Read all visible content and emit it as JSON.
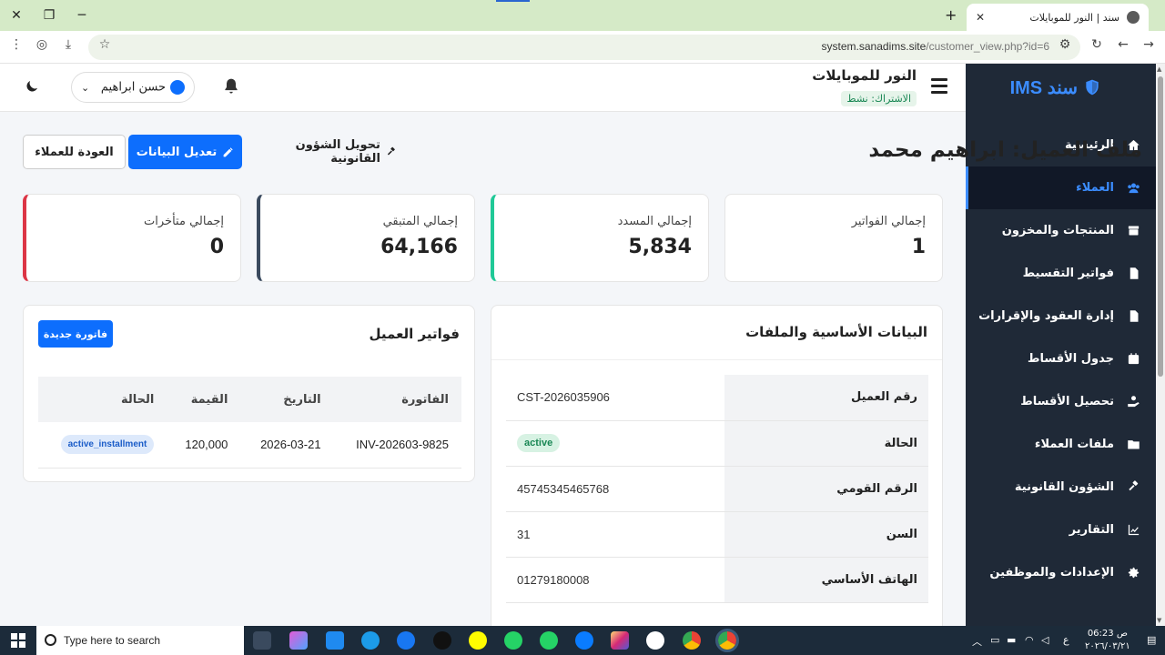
{
  "browser": {
    "tab_title": "سند | النور للموبايلات",
    "url_host": "system.sanadims.site",
    "url_path": "/customer_view.php?id=6"
  },
  "sidebar": {
    "brand": "سند IMS",
    "items": [
      {
        "label": "الرئيسية",
        "icon": "home-icon"
      },
      {
        "label": "العملاء",
        "icon": "users-icon",
        "active": true
      },
      {
        "label": "المنتجات والمخزون",
        "icon": "box-icon"
      },
      {
        "label": "فواتير التقسيط",
        "icon": "invoice-icon"
      },
      {
        "label": "إدارة العقود والإقرارات",
        "icon": "file-icon"
      },
      {
        "label": "جدول الأقساط",
        "icon": "calendar-icon"
      },
      {
        "label": "تحصيل الأقساط",
        "icon": "hand-coins-icon"
      },
      {
        "label": "ملفات العملاء",
        "icon": "folder-icon"
      },
      {
        "label": "الشؤون القانونية",
        "icon": "gavel-icon"
      },
      {
        "label": "التقارير",
        "icon": "chart-icon"
      },
      {
        "label": "الإعدادات والموظفين",
        "icon": "gear-icon"
      }
    ]
  },
  "header": {
    "shop_name": "النور للموبايلات",
    "subscription": "الاشتراك: نشط",
    "user_name": "حسن ابراهيم"
  },
  "page": {
    "title": "ملف العميل: ابراهيم محمد",
    "back_label": "العودة للعملاء",
    "edit_label": "تعديل البيانات",
    "legal_label": "تحويل الشؤون القانونية"
  },
  "stats": [
    {
      "label": "إجمالي الفواتير",
      "value": "1"
    },
    {
      "label": "إجمالي المسدد",
      "value": "5,834"
    },
    {
      "label": "إجمالي المتبقي",
      "value": "64,166"
    },
    {
      "label": "إجمالي متأخرات",
      "value": "0"
    }
  ],
  "info": {
    "title": "البيانات الأساسية والملفات",
    "rows": [
      {
        "key": "رقم العميل",
        "value": "CST-2026035906"
      },
      {
        "key": "الحالة",
        "value": "active"
      },
      {
        "key": "الرقم القومي",
        "value": "45745345465768"
      },
      {
        "key": "السن",
        "value": "31"
      },
      {
        "key": "الهاتف الأساسي",
        "value": "01279180008"
      }
    ]
  },
  "invoices": {
    "title": "فواتير العميل",
    "new_label": "فاتورة جديدة",
    "columns": [
      "الفاتورة",
      "التاريخ",
      "القيمة",
      "الحالة"
    ],
    "rows": [
      {
        "invoice": "INV-202603-9825",
        "date": "2026-03-21",
        "amount": "120,000",
        "status": "active_installment"
      }
    ]
  },
  "taskbar": {
    "search_placeholder": "Type here to search",
    "time": "06:23 ص",
    "date": "٢٠٢٦/٠٣/٢١",
    "lang": "ع"
  },
  "colors": {
    "primary": "#0d6efd",
    "sidebar_bg": "#1f2937",
    "success": "#20c997",
    "danger": "#dc3545"
  }
}
